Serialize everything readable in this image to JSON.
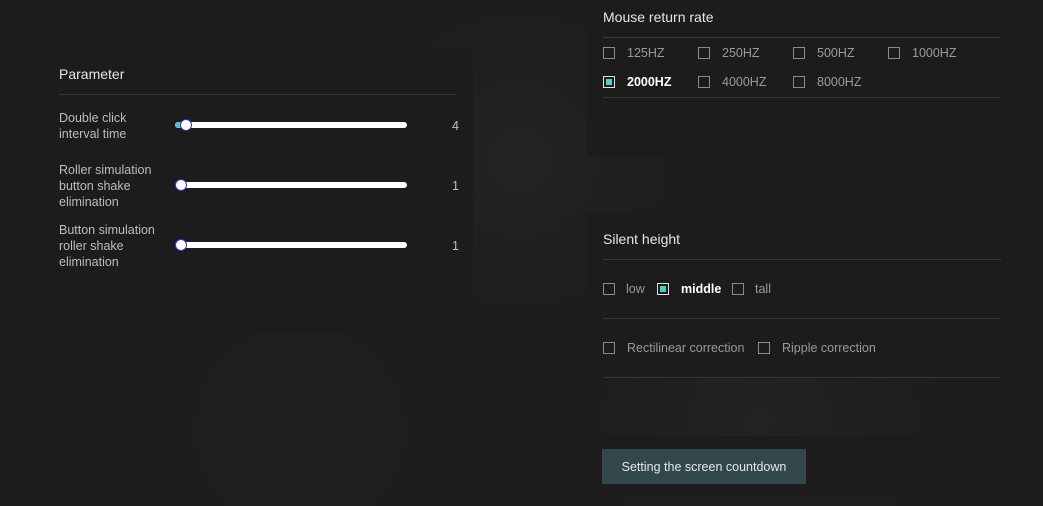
{
  "parameter": {
    "title": "Parameter",
    "rows": [
      {
        "label": "Double click interval time",
        "value": "4",
        "level": 0.02
      },
      {
        "label": "Roller simulation button shake elimination",
        "value": "1",
        "level": 0
      },
      {
        "label": "Button simulation roller shake elimination",
        "value": "1",
        "level": 0
      }
    ]
  },
  "mouse_return_rate": {
    "title": "Mouse return rate",
    "options": [
      "125HZ",
      "250HZ",
      "500HZ",
      "1000HZ",
      "2000HZ",
      "4000HZ",
      "8000HZ"
    ],
    "selected": "2000HZ"
  },
  "silent_height": {
    "title": "Silent height",
    "options": [
      "low",
      "middle",
      "tall"
    ],
    "selected": "middle",
    "corrections": [
      "Rectilinear correction",
      "Ripple correction"
    ]
  },
  "countdown": {
    "button_label": "Setting the screen countdown"
  },
  "colors": {
    "accent": "#4fd1c5",
    "slider_fill": "#4fc3c8",
    "button_bg": "#34474d"
  }
}
